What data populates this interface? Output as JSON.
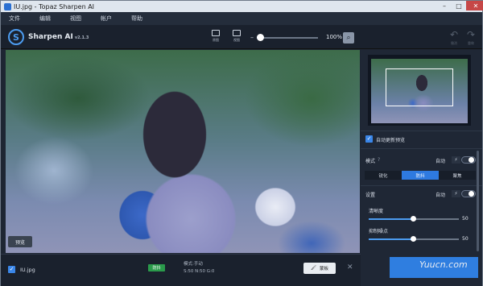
{
  "window": {
    "title": "IU.jpg - Topaz Sharpen AI"
  },
  "menu": [
    "文件",
    "编辑",
    "视图",
    "帐户",
    "帮助"
  ],
  "app": {
    "logo_letter": "S",
    "name": "Sharpen AI",
    "version": "v2.1.3"
  },
  "toolbar": {
    "btn1": "原图",
    "btn2": "视图",
    "zoom_percent": "100%",
    "zoom_level": 0.05,
    "undo": "撤消",
    "redo": "重做"
  },
  "preview": {
    "button": "预览"
  },
  "panel": {
    "auto_update": "自动更新预览",
    "mode_label": "模式",
    "mode_auto": "自动",
    "modes": [
      "锐化",
      "防抖",
      "聚焦"
    ],
    "active_mode": "防抖",
    "settings_label": "设置",
    "settings_auto": "自动",
    "slider1": {
      "label": "清晰度",
      "value": "50"
    },
    "slider2": {
      "label": "抑制噪点",
      "value": "50"
    }
  },
  "bottom": {
    "filename": "IU.jpg",
    "badge": "防抖",
    "mode": "模式:手动",
    "values": "S:50  N:50  G:0",
    "paint": "蒙板"
  },
  "watermark": "Yuucn.com",
  "colors": {
    "accent": "#2e7ae0",
    "badge": "#2a9a4b",
    "panel_bg": "#1f2735"
  }
}
